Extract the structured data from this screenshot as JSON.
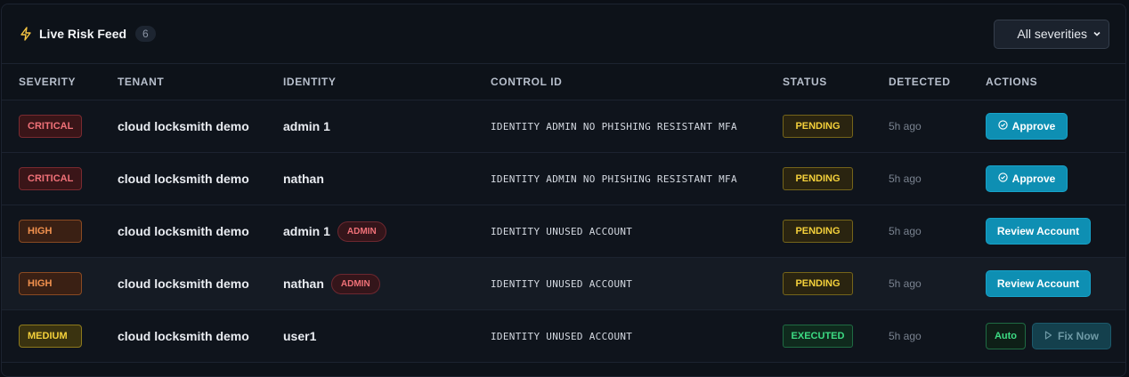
{
  "header": {
    "title": "Live Risk Feed",
    "count": "6",
    "filter": {
      "selected": "All severities"
    }
  },
  "columns": [
    "SEVERITY",
    "TENANT",
    "IDENTITY",
    "CONTROL ID",
    "STATUS",
    "DETECTED",
    "ACTIONS"
  ],
  "rows": [
    {
      "severity": "CRITICAL",
      "tenant": "cloud locksmith demo",
      "identity": "admin 1",
      "badge": "",
      "control": "IDENTITY ADMIN NO PHISHING RESISTANT MFA",
      "status": "PENDING",
      "detected": "5h ago",
      "action": "Approve"
    },
    {
      "severity": "CRITICAL",
      "tenant": "cloud locksmith demo",
      "identity": "nathan",
      "badge": "",
      "control": "IDENTITY ADMIN NO PHISHING RESISTANT MFA",
      "status": "PENDING",
      "detected": "5h ago",
      "action": "Approve"
    },
    {
      "severity": "HIGH",
      "tenant": "cloud locksmith demo",
      "identity": "admin 1",
      "badge": "ADMIN",
      "control": "IDENTITY UNUSED ACCOUNT",
      "status": "PENDING",
      "detected": "5h ago",
      "action": "Review Account"
    },
    {
      "severity": "HIGH",
      "tenant": "cloud locksmith demo",
      "identity": "nathan",
      "badge": "ADMIN",
      "control": "IDENTITY UNUSED ACCOUNT",
      "status": "PENDING",
      "detected": "5h ago",
      "action": "Review Account"
    },
    {
      "severity": "MEDIUM",
      "tenant": "cloud locksmith demo",
      "identity": "user1",
      "badge": "",
      "control": "IDENTITY UNUSED ACCOUNT",
      "status": "EXECUTED",
      "detected": "5h ago",
      "auto_label": "Auto",
      "action": "Fix Now"
    }
  ],
  "icons": {
    "title": "lightning-bolt-icon",
    "approve": "check-circle-icon",
    "fix": "play-icon",
    "select": "chevron-down-icon"
  },
  "colors": {
    "accent": "#0e8fb3",
    "critical": "#f07178",
    "high": "#f2914e",
    "medium": "#f5d13b",
    "pending": "#f5d13b",
    "executed": "#3ddc84"
  }
}
